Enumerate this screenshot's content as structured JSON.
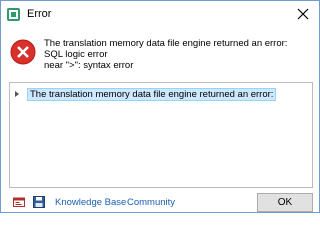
{
  "window": {
    "title": "Error",
    "icons": {
      "app": "trados-app-icon",
      "close": "close-icon",
      "error": "error-icon"
    }
  },
  "message": {
    "lines": [
      "The translation memory data file engine returned an error:",
      "SQL logic error",
      "near \">\": syntax error"
    ]
  },
  "details": {
    "items": [
      {
        "label": "The translation memory data file engine returned an error:",
        "expanded": false,
        "selected": true
      }
    ]
  },
  "footer": {
    "icons": [
      "email-icon",
      "save-icon"
    ],
    "links": [
      "Knowledge Base",
      "Community"
    ],
    "ok_label": "OK"
  },
  "colors": {
    "accent": "#1a5fb4",
    "error_red": "#d9302b",
    "selection": "#cce8ff"
  }
}
